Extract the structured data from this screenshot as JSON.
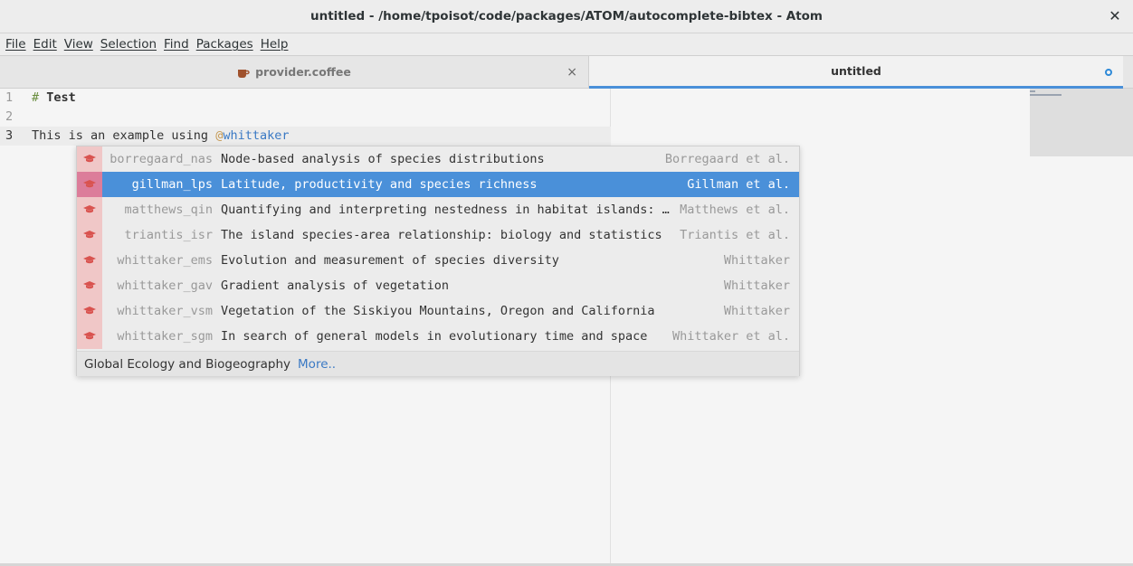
{
  "window": {
    "title": "untitled - /home/tpoisot/code/packages/ATOM/autocomplete-bibtex - Atom",
    "close_glyph": "✕"
  },
  "menu": [
    "File",
    "Edit",
    "View",
    "Selection",
    "Find",
    "Packages",
    "Help"
  ],
  "tabs": {
    "left": {
      "label": "provider.coffee",
      "icon": "coffee-file-icon",
      "close_glyph": "×"
    },
    "right": {
      "label": "untitled",
      "modified_indicator": "modified-dot-icon"
    }
  },
  "editor": {
    "lines": [
      {
        "num": "1",
        "hash": "#",
        "heading": "Test"
      },
      {
        "num": "2"
      },
      {
        "num": "3",
        "text": "This is an example using ",
        "at": "@",
        "cite": "whittaker"
      }
    ]
  },
  "autocomplete": {
    "items": [
      {
        "key": "borregaard_nas",
        "title": "Node-based analysis of species distributions",
        "author": "Borregaard et al.",
        "selected": false
      },
      {
        "key": "gillman_lps",
        "title": "Latitude, productivity and species richness",
        "author": "Gillman et al.",
        "selected": true
      },
      {
        "key": "matthews_qin",
        "title": "Quantifying and interpreting nestedness in habitat islands: a…",
        "author": "Matthews et al.",
        "selected": false
      },
      {
        "key": "triantis_isr",
        "title": "The island species-area relationship: biology and statistics",
        "author": "Triantis et al.",
        "selected": false
      },
      {
        "key": "whittaker_ems",
        "title": "Evolution and measurement of species diversity",
        "author": "Whittaker",
        "selected": false
      },
      {
        "key": "whittaker_gav",
        "title": "Gradient analysis of vegetation",
        "author": "Whittaker",
        "selected": false
      },
      {
        "key": "whittaker_vsm",
        "title": "Vegetation of the Siskiyou Mountains, Oregon and California",
        "author": "Whittaker",
        "selected": false
      },
      {
        "key": "whittaker_sgm",
        "title": "In search of general models in evolutionary time and space",
        "author": "Whittaker et al.",
        "selected": false
      }
    ],
    "footer": {
      "description": "Global Ecology and Biogeography",
      "more_label": "More.."
    },
    "item_icon": "graduation-cap-icon"
  },
  "colors": {
    "accent": "#4a90d9",
    "icon_cell": "#f0c7c7",
    "icon_glyph": "#d9534f",
    "link": "#3a79c4",
    "modified_dot": "#2f8ad8"
  }
}
